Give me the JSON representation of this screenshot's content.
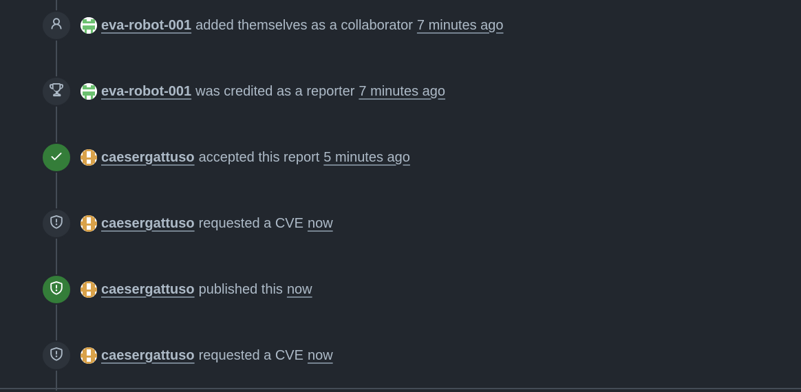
{
  "timeline": {
    "events": [
      {
        "icon": "person-icon",
        "badge_style": "neutral",
        "avatar": "eva-robot-avatar",
        "author": "eva-robot-001",
        "action": "added themselves as a collaborator",
        "time": "7 minutes ago"
      },
      {
        "icon": "trophy-icon",
        "badge_style": "neutral",
        "avatar": "eva-robot-avatar",
        "author": "eva-robot-001",
        "action": "was credited as a reporter",
        "time": "7 minutes ago"
      },
      {
        "icon": "check-icon",
        "badge_style": "success",
        "avatar": "caesergattuso-avatar",
        "author": "caesergattuso",
        "action": "accepted this report",
        "time": "5 minutes ago"
      },
      {
        "icon": "shield-icon",
        "badge_style": "neutral",
        "avatar": "caesergattuso-avatar",
        "author": "caesergattuso",
        "action": "requested a CVE",
        "time": "now"
      },
      {
        "icon": "shield-icon",
        "badge_style": "success",
        "avatar": "caesergattuso-avatar",
        "author": "caesergattuso",
        "action": "published this",
        "time": "now"
      },
      {
        "icon": "shield-icon",
        "badge_style": "neutral",
        "avatar": "caesergattuso-avatar",
        "author": "caesergattuso",
        "action": "requested a CVE",
        "time": "now"
      }
    ]
  },
  "colors": {
    "background": "#22272e",
    "text": "#adbac7",
    "badge_neutral": "#2d333b",
    "badge_success": "#347d39",
    "timeline_line": "#444c56"
  }
}
